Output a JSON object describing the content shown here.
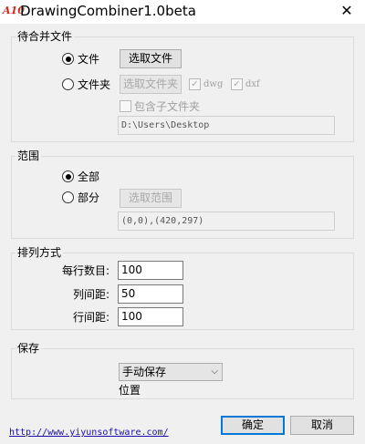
{
  "window": {
    "icon_text": "A10",
    "title": "DrawingCombiner1.0beta",
    "close_glyph": "✕"
  },
  "files_group": {
    "title": "待合并文件",
    "radio_file_label": "文件",
    "select_file_button": "选取文件",
    "radio_folder_label": "文件夹",
    "select_folder_button": "选取文件夹",
    "dwg_label": "dwg",
    "dxf_label": "dxf",
    "include_subfolders_label": "包含子文件夹",
    "folder_path": "D:\\Users\\Desktop"
  },
  "range_group": {
    "title": "范围",
    "radio_all_label": "全部",
    "radio_part_label": "部分",
    "select_range_button": "选取范围",
    "range_value": "(0,0),(420,297)"
  },
  "layout_group": {
    "title": "排列方式",
    "per_row_label": "每行数目:",
    "per_row_value": "100",
    "col_spacing_label": "列间距:",
    "col_spacing_value": "50",
    "row_spacing_label": "行间距:",
    "row_spacing_value": "100"
  },
  "save_group": {
    "title": "保存",
    "save_mode": "手动保存",
    "location_label": "位置"
  },
  "footer": {
    "link": "http://www.yiyunsoftware.com/",
    "ok_button": "确定",
    "cancel_button": "取消"
  }
}
